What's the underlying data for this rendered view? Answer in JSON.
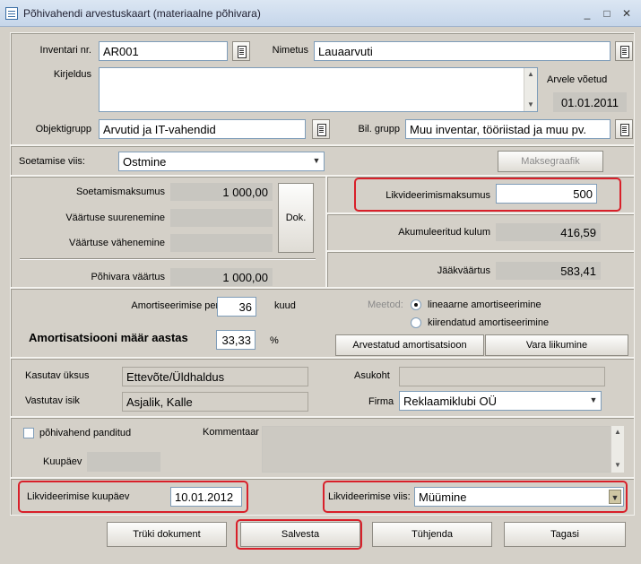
{
  "window": {
    "title": "Põhivahendi arvestuskaart (materiaalne põhivara)"
  },
  "header": {
    "inventari_label": "Inventari nr.",
    "inventari_value": "AR001",
    "nimetus_label": "Nimetus",
    "nimetus_value": "Lauaarvuti",
    "kirjeldus_label": "Kirjeldus",
    "kirjeldus_value": "",
    "arvele_label": "Arvele võetud",
    "arvele_value": "01.01.2011",
    "objektigrupp_label": "Objektigrupp",
    "objektigrupp_value": "Arvutid ja IT-vahendid",
    "bilgrupp_label": "Bil. grupp",
    "bilgrupp_value": "Muu inventar, tööriistad ja muu pv."
  },
  "acquisition": {
    "soetamise_label": "Soetamise viis:",
    "soetamise_value": "Ostmine",
    "maksegraafik_label": "Maksegraafik"
  },
  "values": {
    "soetamismaksumus_label": "Soetamismaksumus",
    "soetamismaksumus_value": "1 000,00",
    "suurenemine_label": "Väärtuse suurenemine",
    "suurenemine_value": "",
    "vahenemine_label": "Väärtuse vähenemine",
    "vahenemine_value": "",
    "dok_label": "Dok.",
    "pohivara_label": "Põhivara väärtus",
    "pohivara_value": "1 000,00",
    "likvmaksumus_label": "Likvideerimismaksumus",
    "likvmaksumus_value": "500",
    "akumuleeritud_label": "Akumuleeritud kulum",
    "akumuleeritud_value": "416,59",
    "jaakvaartus_label": "Jääkväärtus",
    "jaakvaartus_value": "583,41"
  },
  "amortization": {
    "periood_label": "Amortiseerimise periood",
    "periood_value": "36",
    "periood_unit": "kuud",
    "maar_label": "Amortisatsiooni määr aastas",
    "maar_value": "33,33",
    "maar_unit": "%",
    "meetod_label": "Meetod:",
    "lineaarne_label": "lineaarne amortiseerimine",
    "kiirendatud_label": "kiirendatud amortiseerimine",
    "arvestatud_label": "Arvestatud amortisatsioon",
    "liikumine_label": "Vara liikumine"
  },
  "responsibility": {
    "kasutav_label": "Kasutav üksus",
    "kasutav_value": "Ettevõte/Üldhaldus",
    "vastutav_label": "Vastutav isik",
    "vastutav_value": "Asjalik, Kalle",
    "asukoht_label": "Asukoht",
    "asukoht_value": "",
    "firma_label": "Firma",
    "firma_value": "Reklaamiklubi OÜ"
  },
  "pledge": {
    "panditud_label": "põhivahend panditud",
    "kuupaev_label": "Kuupäev",
    "kuupaev_value": "",
    "kommentaar_label": "Kommentaar",
    "kommentaar_value": ""
  },
  "liquidation": {
    "kuupaev_label": "Likvideerimise kuupäev",
    "kuupaev_value": "10.01.2012",
    "viis_label": "Likvideerimise viis:",
    "viis_value": "Müümine"
  },
  "footer": {
    "print_label": "Trüki dokument",
    "save_label": "Salvesta",
    "clear_label": "Tühjenda",
    "back_label": "Tagasi"
  },
  "colors": {
    "highlight": "#d8202a",
    "window_bg": "#d4d0c8",
    "readonly_bg": "#c8c6c0"
  }
}
